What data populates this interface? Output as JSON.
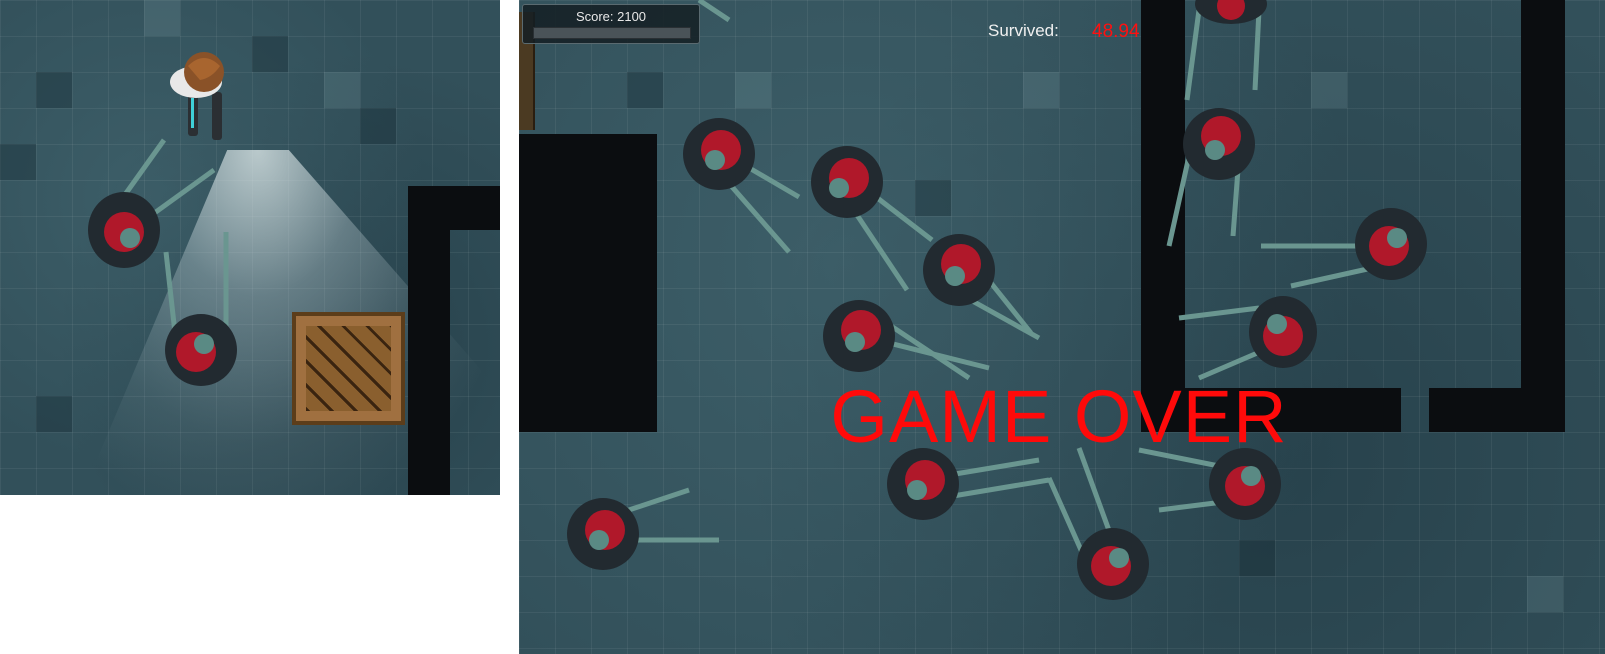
{
  "hud": {
    "score_label": "Score: 2100",
    "survived_label": "Survived:",
    "survived_value": "48.94"
  },
  "game_over_text": "GAME OVER",
  "colors": {
    "floor": "#32505a",
    "wall": "#0b0d10",
    "zombie_hair": "#b0182a",
    "zombie_skin": "#5a8a84",
    "game_over": "#ff0a0a",
    "survived_value": "#ff1010"
  }
}
